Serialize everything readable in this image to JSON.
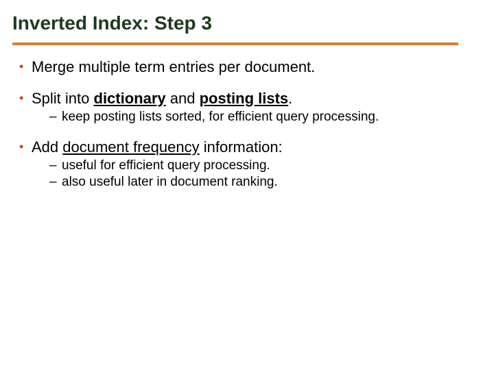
{
  "title": "Inverted Index: Step 3",
  "bullets": {
    "b1": {
      "text": "Merge multiple term entries per document."
    },
    "b2": {
      "pre": "Split into ",
      "strong1": "dictionary",
      "mid": " and ",
      "strong2": "posting lists",
      "post": ".",
      "sub1": "keep posting lists sorted, for efficient query processing."
    },
    "b3": {
      "pre": "Add ",
      "u1": "document frequency",
      "post": " information:",
      "sub1": "useful for efficient query processing.",
      "sub2": "also useful later in document ranking."
    }
  }
}
